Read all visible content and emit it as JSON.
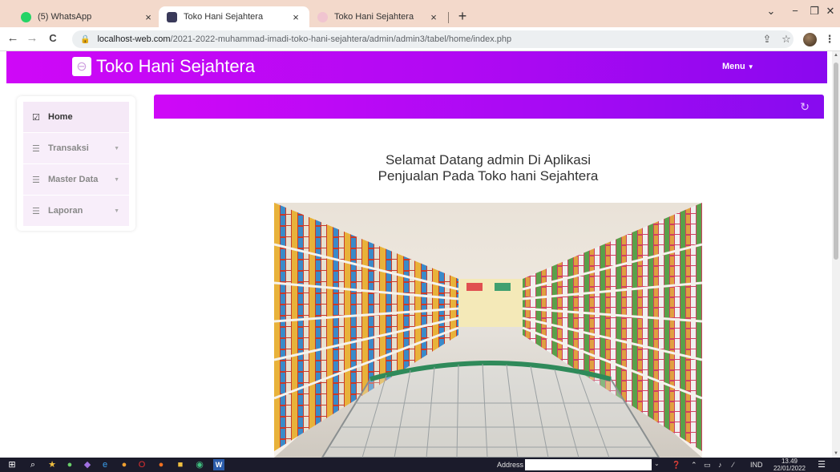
{
  "browser": {
    "tabs": [
      {
        "title": "(5) WhatsApp",
        "favicon_color": "#25d366",
        "close": "×"
      },
      {
        "title": "Toko Hani Sejahtera",
        "favicon_color": "#3a3a5a",
        "close": "×"
      },
      {
        "title": "Toko Hani Sejahtera",
        "favicon_color": "#f0c4d0",
        "close": "×"
      }
    ],
    "new_tab": "+",
    "window_controls": {
      "dropdown": "⌄",
      "minimize": "−",
      "restore": "❐",
      "close": "✕"
    },
    "nav": {
      "back": "←",
      "forward": "→",
      "reload": "C"
    },
    "address": {
      "host": "localhost-web.com",
      "path": "/2021-2022-muhammad-imadi-toko-hani-sejahtera/admin/admin3/tabel/home/index.php"
    },
    "toolbar_icons": {
      "share": "⇪",
      "bookmark": "☆",
      "more": "⋮"
    }
  },
  "app": {
    "brand": "Toko Hani Sejahtera",
    "menu_label": "Menu",
    "accent": "#c70af7",
    "accent_end": "#8a08ef"
  },
  "sidebar": {
    "items": [
      {
        "label": "Home",
        "icon": "edit-icon",
        "glyph": "☑"
      },
      {
        "label": "Transaksi",
        "icon": "list-icon",
        "glyph": "☰"
      },
      {
        "label": "Master Data",
        "icon": "list-icon",
        "glyph": "☰"
      },
      {
        "label": "Laporan",
        "icon": "list-icon",
        "glyph": "☰"
      }
    ]
  },
  "main": {
    "welcome_line1": "Selamat Datang admin Di Aplikasi",
    "welcome_line2": "Penjualan Pada Toko hani Sejahtera"
  },
  "taskbar": {
    "address_label": "Address",
    "language": "IND",
    "time": "13.49",
    "date": "22/01/2022"
  }
}
